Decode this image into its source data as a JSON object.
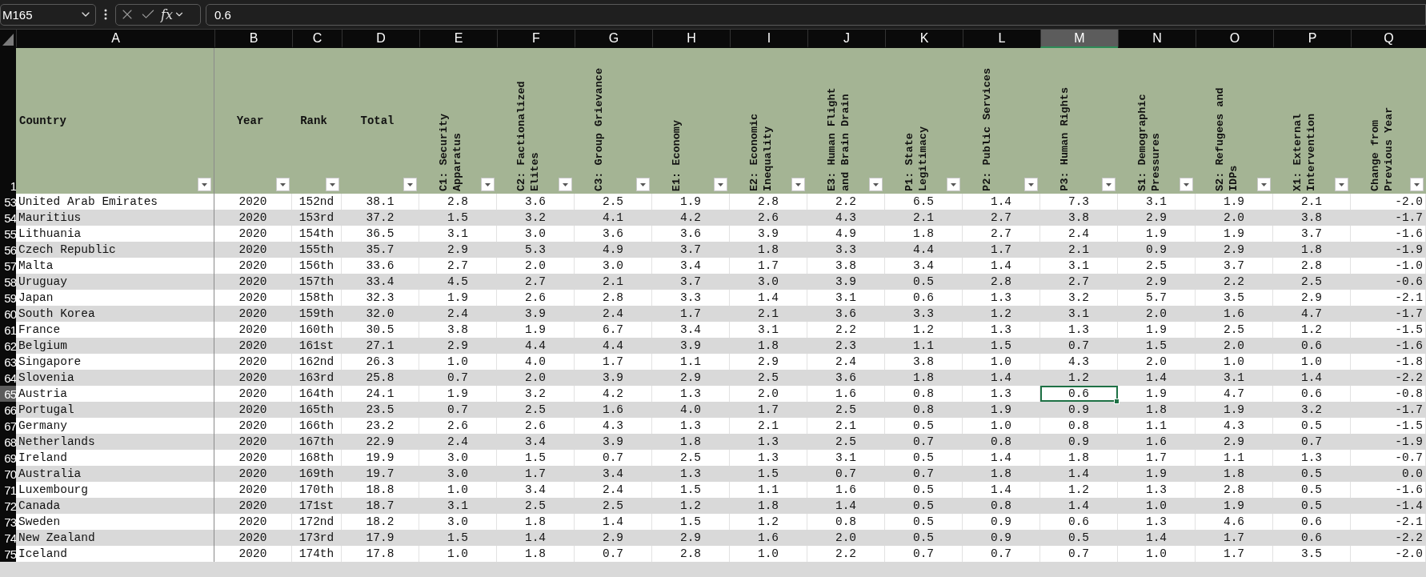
{
  "name_box": "M165",
  "function_button": "fx",
  "formula": "0.6",
  "columns": [
    {
      "letter": "A",
      "selected": false
    },
    {
      "letter": "B",
      "selected": false
    },
    {
      "letter": "C",
      "selected": false
    },
    {
      "letter": "D",
      "selected": false
    },
    {
      "letter": "E",
      "selected": false
    },
    {
      "letter": "F",
      "selected": false
    },
    {
      "letter": "G",
      "selected": false
    },
    {
      "letter": "H",
      "selected": false
    },
    {
      "letter": "I",
      "selected": false
    },
    {
      "letter": "J",
      "selected": false
    },
    {
      "letter": "K",
      "selected": false
    },
    {
      "letter": "L",
      "selected": false
    },
    {
      "letter": "M",
      "selected": true
    },
    {
      "letter": "N",
      "selected": false
    },
    {
      "letter": "O",
      "selected": false
    },
    {
      "letter": "P",
      "selected": false
    },
    {
      "letter": "Q",
      "selected": false
    }
  ],
  "header_row_number": "1",
  "headers": [
    {
      "label": "Country",
      "kind": "horizontal"
    },
    {
      "label": "Year",
      "kind": "horizontal"
    },
    {
      "label": "Rank",
      "kind": "horizontal"
    },
    {
      "label": "Total",
      "kind": "horizontal"
    },
    {
      "label": "C1: Security Apparatus",
      "kind": "vertical"
    },
    {
      "label": "C2: Factionalized Elites",
      "kind": "vertical"
    },
    {
      "label": "C3: Group Grievance",
      "kind": "vertical"
    },
    {
      "label": "E1: Economy",
      "kind": "vertical"
    },
    {
      "label": "E2: Economic Inequality",
      "kind": "vertical"
    },
    {
      "label": "E3: Human Flight and Brain Drain",
      "kind": "vertical"
    },
    {
      "label": "P1: State Legitimacy",
      "kind": "vertical"
    },
    {
      "label": "P2: Public Services",
      "kind": "vertical"
    },
    {
      "label": "P3: Human Rights",
      "kind": "vertical"
    },
    {
      "label": "S1: Demographic Pressures",
      "kind": "vertical"
    },
    {
      "label": "S2: Refugees and IDPs",
      "kind": "vertical"
    },
    {
      "label": "X1: External Intervention",
      "kind": "vertical"
    },
    {
      "label": "Change from Previous Year",
      "kind": "vertical"
    }
  ],
  "rows": [
    {
      "number": "53",
      "selected": false,
      "cells": [
        "United Arab Emirates",
        "2020",
        "152nd",
        "38.1",
        "2.8",
        "3.6",
        "2.5",
        "1.9",
        "2.8",
        "2.2",
        "6.5",
        "1.4",
        "7.3",
        "3.1",
        "1.9",
        "2.1",
        "-2.0"
      ]
    },
    {
      "number": "54",
      "selected": false,
      "cells": [
        "Mauritius",
        "2020",
        "153rd",
        "37.2",
        "1.5",
        "3.2",
        "4.1",
        "4.2",
        "2.6",
        "4.3",
        "2.1",
        "2.7",
        "3.8",
        "2.9",
        "2.0",
        "3.8",
        "-1.7"
      ]
    },
    {
      "number": "55",
      "selected": false,
      "cells": [
        "Lithuania",
        "2020",
        "154th",
        "36.5",
        "3.1",
        "3.0",
        "3.6",
        "3.6",
        "3.9",
        "4.9",
        "1.8",
        "2.7",
        "2.4",
        "1.9",
        "1.9",
        "3.7",
        "-1.6"
      ]
    },
    {
      "number": "56",
      "selected": false,
      "cells": [
        "Czech Republic",
        "2020",
        "155th",
        "35.7",
        "2.9",
        "5.3",
        "4.9",
        "3.7",
        "1.8",
        "3.3",
        "4.4",
        "1.7",
        "2.1",
        "0.9",
        "2.9",
        "1.8",
        "-1.9"
      ]
    },
    {
      "number": "57",
      "selected": false,
      "cells": [
        "Malta",
        "2020",
        "156th",
        "33.6",
        "2.7",
        "2.0",
        "3.0",
        "3.4",
        "1.7",
        "3.8",
        "3.4",
        "1.4",
        "3.1",
        "2.5",
        "3.7",
        "2.8",
        "-1.0"
      ]
    },
    {
      "number": "58",
      "selected": false,
      "cells": [
        "Uruguay",
        "2020",
        "157th",
        "33.4",
        "4.5",
        "2.7",
        "2.1",
        "3.7",
        "3.0",
        "3.9",
        "0.5",
        "2.8",
        "2.7",
        "2.9",
        "2.2",
        "2.5",
        "-0.6"
      ]
    },
    {
      "number": "59",
      "selected": false,
      "cells": [
        "Japan",
        "2020",
        "158th",
        "32.3",
        "1.9",
        "2.6",
        "2.8",
        "3.3",
        "1.4",
        "3.1",
        "0.6",
        "1.3",
        "3.2",
        "5.7",
        "3.5",
        "2.9",
        "-2.1"
      ]
    },
    {
      "number": "60",
      "selected": false,
      "cells": [
        "South Korea",
        "2020",
        "159th",
        "32.0",
        "2.4",
        "3.9",
        "2.4",
        "1.7",
        "2.1",
        "3.6",
        "3.3",
        "1.2",
        "3.1",
        "2.0",
        "1.6",
        "4.7",
        "-1.7"
      ]
    },
    {
      "number": "61",
      "selected": false,
      "cells": [
        "France",
        "2020",
        "160th",
        "30.5",
        "3.8",
        "1.9",
        "6.7",
        "3.4",
        "3.1",
        "2.2",
        "1.2",
        "1.3",
        "1.3",
        "1.9",
        "2.5",
        "1.2",
        "-1.5"
      ]
    },
    {
      "number": "62",
      "selected": false,
      "cells": [
        "Belgium",
        "2020",
        "161st",
        "27.1",
        "2.9",
        "4.4",
        "4.4",
        "3.9",
        "1.8",
        "2.3",
        "1.1",
        "1.5",
        "0.7",
        "1.5",
        "2.0",
        "0.6",
        "-1.6"
      ]
    },
    {
      "number": "63",
      "selected": false,
      "cells": [
        "Singapore",
        "2020",
        "162nd",
        "26.3",
        "1.0",
        "4.0",
        "1.7",
        "1.1",
        "2.9",
        "2.4",
        "3.8",
        "1.0",
        "4.3",
        "2.0",
        "1.0",
        "1.0",
        "-1.8"
      ]
    },
    {
      "number": "64",
      "selected": false,
      "cells": [
        "Slovenia",
        "2020",
        "163rd",
        "25.8",
        "0.7",
        "2.0",
        "3.9",
        "2.9",
        "2.5",
        "3.6",
        "1.8",
        "1.4",
        "1.2",
        "1.4",
        "3.1",
        "1.4",
        "-2.2"
      ]
    },
    {
      "number": "65",
      "selected": true,
      "cells": [
        "Austria",
        "2020",
        "164th",
        "24.1",
        "1.9",
        "3.2",
        "4.2",
        "1.3",
        "2.0",
        "1.6",
        "0.8",
        "1.3",
        "0.6",
        "1.9",
        "4.7",
        "0.6",
        "-0.8"
      ]
    },
    {
      "number": "66",
      "selected": false,
      "cells": [
        "Portugal",
        "2020",
        "165th",
        "23.5",
        "0.7",
        "2.5",
        "1.6",
        "4.0",
        "1.7",
        "2.5",
        "0.8",
        "1.9",
        "0.9",
        "1.8",
        "1.9",
        "3.2",
        "-1.7"
      ]
    },
    {
      "number": "67",
      "selected": false,
      "cells": [
        "Germany",
        "2020",
        "166th",
        "23.2",
        "2.6",
        "2.6",
        "4.3",
        "1.3",
        "2.1",
        "2.1",
        "0.5",
        "1.0",
        "0.8",
        "1.1",
        "4.3",
        "0.5",
        "-1.5"
      ]
    },
    {
      "number": "68",
      "selected": false,
      "cells": [
        "Netherlands",
        "2020",
        "167th",
        "22.9",
        "2.4",
        "3.4",
        "3.9",
        "1.8",
        "1.3",
        "2.5",
        "0.7",
        "0.8",
        "0.9",
        "1.6",
        "2.9",
        "0.7",
        "-1.9"
      ]
    },
    {
      "number": "69",
      "selected": false,
      "cells": [
        "Ireland",
        "2020",
        "168th",
        "19.9",
        "3.0",
        "1.5",
        "0.7",
        "2.5",
        "1.3",
        "3.1",
        "0.5",
        "1.4",
        "1.8",
        "1.7",
        "1.1",
        "1.3",
        "-0.7"
      ]
    },
    {
      "number": "70",
      "selected": false,
      "cells": [
        "Australia",
        "2020",
        "169th",
        "19.7",
        "3.0",
        "1.7",
        "3.4",
        "1.3",
        "1.5",
        "0.7",
        "0.7",
        "1.8",
        "1.4",
        "1.9",
        "1.8",
        "0.5",
        "0.0"
      ]
    },
    {
      "number": "71",
      "selected": false,
      "cells": [
        "Luxembourg",
        "2020",
        "170th",
        "18.8",
        "1.0",
        "3.4",
        "2.4",
        "1.5",
        "1.1",
        "1.6",
        "0.5",
        "1.4",
        "1.2",
        "1.3",
        "2.8",
        "0.5",
        "-1.6"
      ]
    },
    {
      "number": "72",
      "selected": false,
      "cells": [
        "Canada",
        "2020",
        "171st",
        "18.7",
        "3.1",
        "2.5",
        "2.5",
        "1.2",
        "1.8",
        "1.4",
        "0.5",
        "0.8",
        "1.4",
        "1.0",
        "1.9",
        "0.5",
        "-1.4"
      ]
    },
    {
      "number": "73",
      "selected": false,
      "cells": [
        "Sweden",
        "2020",
        "172nd",
        "18.2",
        "3.0",
        "1.8",
        "1.4",
        "1.5",
        "1.2",
        "0.8",
        "0.5",
        "0.9",
        "0.6",
        "1.3",
        "4.6",
        "0.6",
        "-2.1"
      ]
    },
    {
      "number": "74",
      "selected": false,
      "cells": [
        "New Zealand",
        "2020",
        "173rd",
        "17.9",
        "1.5",
        "1.4",
        "2.9",
        "2.9",
        "1.6",
        "2.0",
        "0.5",
        "0.9",
        "0.5",
        "1.4",
        "1.7",
        "0.6",
        "-2.2"
      ]
    },
    {
      "number": "75",
      "selected": false,
      "cells": [
        "Iceland",
        "2020",
        "174th",
        "17.8",
        "1.0",
        "1.8",
        "0.7",
        "2.8",
        "1.0",
        "2.2",
        "0.7",
        "0.7",
        "0.7",
        "1.0",
        "1.7",
        "3.5",
        "-2.0"
      ]
    }
  ]
}
